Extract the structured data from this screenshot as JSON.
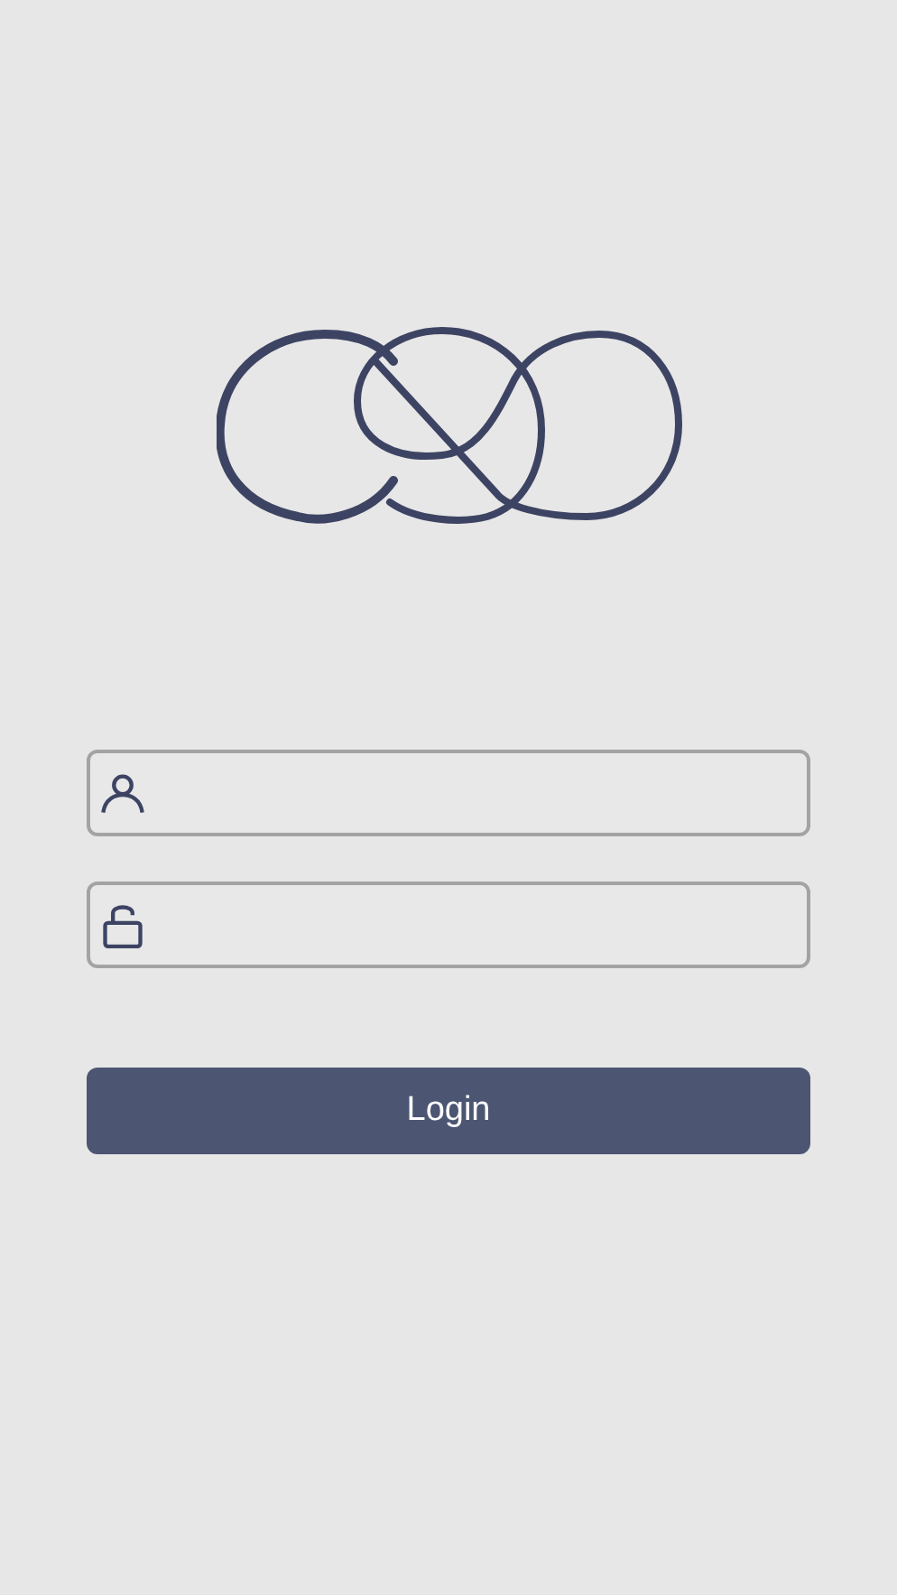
{
  "fields": [
    {
      "kind": "user"
    },
    {
      "kind": "password"
    }
  ],
  "login_button": {
    "label": "Login"
  }
}
